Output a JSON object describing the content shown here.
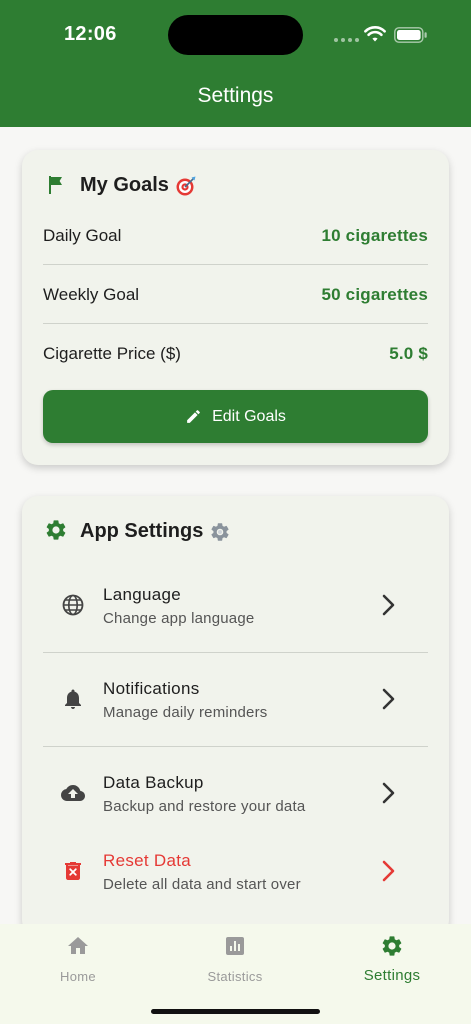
{
  "status_bar": {
    "time": "12:06"
  },
  "header": {
    "title": "Settings"
  },
  "goals": {
    "title": "My Goals",
    "rows": [
      {
        "label": "Daily Goal",
        "value": "10 cigarettes"
      },
      {
        "label": "Weekly Goal",
        "value": "50 cigarettes"
      },
      {
        "label": "Cigarette Price ($)",
        "value": "5.0 $"
      }
    ],
    "edit_label": "Edit Goals"
  },
  "app_settings": {
    "title": "App Settings",
    "items": [
      {
        "title": "Language",
        "subtitle": "Change app language",
        "icon": "globe-icon"
      },
      {
        "title": "Notifications",
        "subtitle": "Manage daily reminders",
        "icon": "bell-icon"
      },
      {
        "title": "Data Backup",
        "subtitle": "Backup and restore your data",
        "icon": "cloud-upload-icon"
      },
      {
        "title": "Reset Data",
        "subtitle": "Delete all data and start over",
        "icon": "delete-icon"
      }
    ]
  },
  "nav": {
    "items": [
      {
        "label": "Home",
        "icon": "home-icon"
      },
      {
        "label": "Statistics",
        "icon": "statistics-icon"
      },
      {
        "label": "Settings",
        "icon": "gear-icon",
        "active": true
      }
    ]
  },
  "colors": {
    "primary": "#2e7d32",
    "danger": "#e53935",
    "card": "#f1f3ec",
    "nav_bg": "#f5f9ec",
    "inactive": "#9a9a9a"
  }
}
